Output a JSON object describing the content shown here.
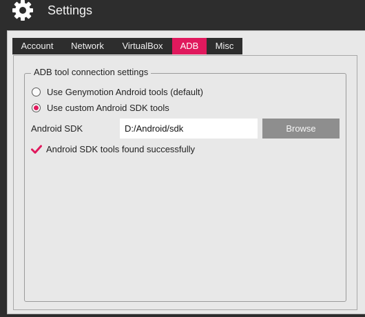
{
  "window": {
    "title": "Settings",
    "icon": "gear-icon"
  },
  "tabs": [
    {
      "label": "Account",
      "active": false
    },
    {
      "label": "Network",
      "active": false
    },
    {
      "label": "VirtualBox",
      "active": false
    },
    {
      "label": "ADB",
      "active": true
    },
    {
      "label": "Misc",
      "active": false
    }
  ],
  "adb": {
    "group_title": "ADB tool connection settings",
    "options": [
      {
        "label": "Use Genymotion Android tools (default)",
        "selected": false
      },
      {
        "label": "Use custom Android SDK tools",
        "selected": true
      }
    ],
    "sdk_label": "Android SDK",
    "sdk_path": "D:/Android/sdk",
    "browse_label": "Browse",
    "status_icon": "check-icon",
    "status_text": "Android SDK tools found successfully"
  },
  "colors": {
    "accent": "#e0195d",
    "titlebar": "#2d2d2d",
    "panel": "#e8e8e8",
    "button": "#8e8e8e"
  }
}
